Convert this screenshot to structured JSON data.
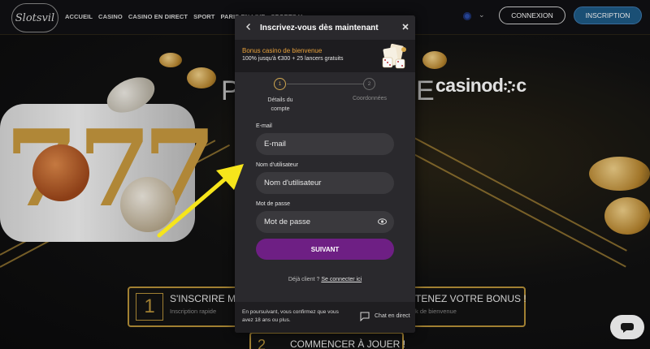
{
  "header": {
    "logo_text": "Slotsvil",
    "nav": [
      "ACCUEIL",
      "CASINO",
      "CASINO EN DIRECT",
      "SPORT",
      "PARIS EN LIVE",
      "SPORTS V"
    ],
    "login_label": "CONNEXION",
    "register_label": "INSCRIPTION",
    "lang_icon": "flag-icon"
  },
  "hero": {
    "brand_overlay": "casinodoc",
    "heading_left": "P",
    "heading_right": "E",
    "step1": {
      "number": "1",
      "title": "S'INSCRIRE MA",
      "subtitle": "Inscription rapide"
    },
    "step2": {
      "title": "TENEZ VOTRE BONUS !",
      "subtitle": "k de bienvenue"
    },
    "step3": {
      "number": "2",
      "title": "COMMENCER À JOUER !"
    }
  },
  "modal": {
    "title": "Inscrivez-vous dès maintenant",
    "bonus_title": "Bonus casino de bienvenue",
    "bonus_text": "100% jusqu'à €300 + 25 lancers gratuits",
    "steps": [
      {
        "number": "1",
        "label": "Détails du compte"
      },
      {
        "number": "2",
        "label": "Coordonnées"
      }
    ],
    "email": {
      "label": "E-mail",
      "placeholder": "E-mail"
    },
    "username": {
      "label": "Nom d'utilisateur",
      "placeholder": "Nom d'utilisateur"
    },
    "password": {
      "label": "Mot de passe",
      "placeholder": "Mot de passe"
    },
    "submit_label": "SUIVANT",
    "login_prompt": "Déjà client ?",
    "login_link": "Se connecter ici",
    "footer_text": "En poursuivant, vous confirmez que vous avez 18 ans ou plus.",
    "chat_label": "Chat en direct"
  },
  "colors": {
    "accent_gold": "#d1a851",
    "submit_purple": "#6e1f84",
    "register_blue": "#1e5a86",
    "annotation_arrow": "#f6e51b"
  }
}
